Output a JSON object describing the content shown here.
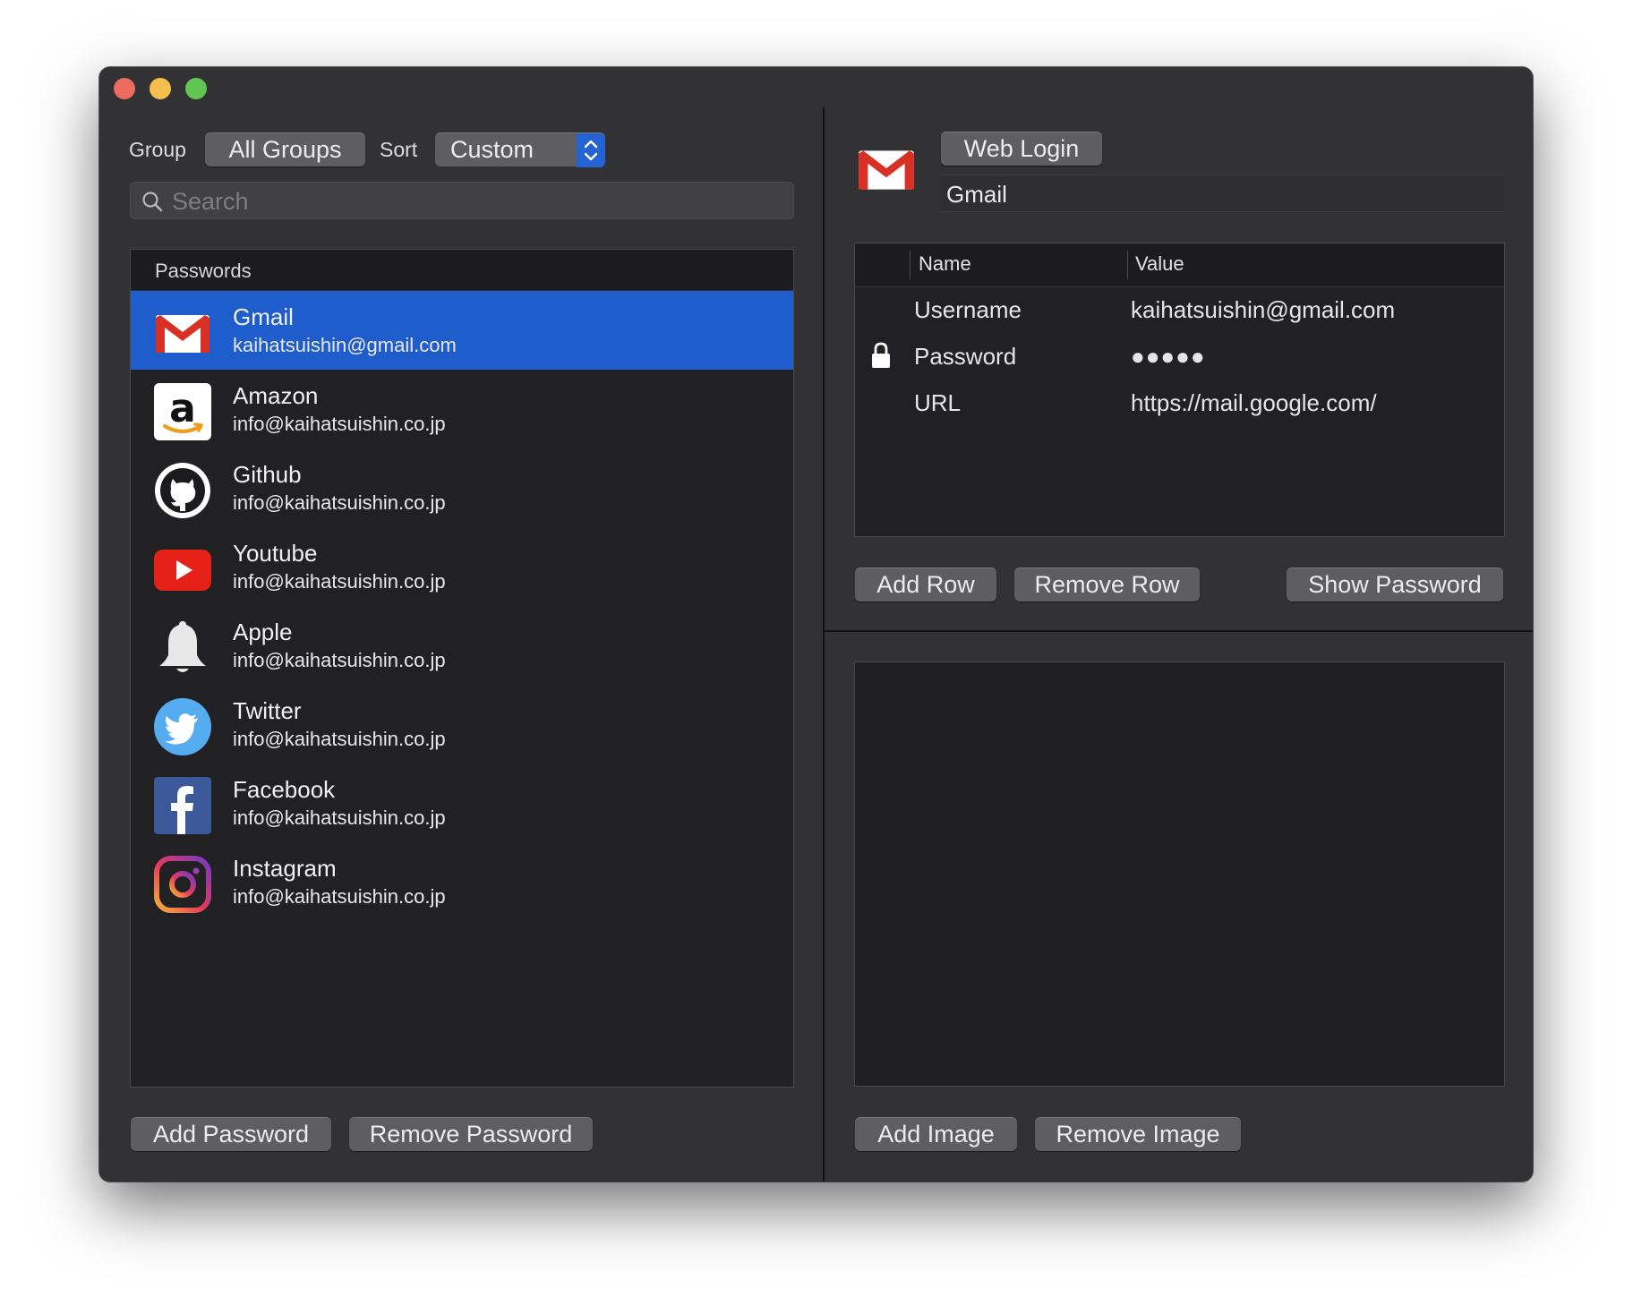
{
  "toolbar": {
    "group_label": "Group",
    "group_value": "All Groups",
    "sort_label": "Sort",
    "sort_value": "Custom",
    "search_placeholder": "Search"
  },
  "list": {
    "header": "Passwords",
    "items": [
      {
        "title": "Gmail",
        "subtitle": "kaihatsuishin@gmail.com",
        "icon": "gmail-icon",
        "selected": true
      },
      {
        "title": "Amazon",
        "subtitle": "info@kaihatsuishin.co.jp",
        "icon": "amazon-icon"
      },
      {
        "title": "Github",
        "subtitle": "info@kaihatsuishin.co.jp",
        "icon": "github-icon"
      },
      {
        "title": "Youtube",
        "subtitle": "info@kaihatsuishin.co.jp",
        "icon": "youtube-icon"
      },
      {
        "title": "Apple",
        "subtitle": "info@kaihatsuishin.co.jp",
        "icon": "bell-icon"
      },
      {
        "title": "Twitter",
        "subtitle": "info@kaihatsuishin.co.jp",
        "icon": "twitter-icon"
      },
      {
        "title": "Facebook",
        "subtitle": "info@kaihatsuishin.co.jp",
        "icon": "facebook-icon"
      },
      {
        "title": "Instagram",
        "subtitle": "info@kaihatsuishin.co.jp",
        "icon": "instagram-icon"
      }
    ]
  },
  "left_buttons": {
    "add": "Add Password",
    "remove": "Remove Password"
  },
  "detail": {
    "type_button": "Web Login",
    "title": "Gmail",
    "table": {
      "columns": [
        "Name",
        "Value"
      ],
      "rows": [
        {
          "name": "Username",
          "value": "kaihatsuishin@gmail.com",
          "locked": false
        },
        {
          "name": "Password",
          "value": "●●●●●",
          "locked": true
        },
        {
          "name": "URL",
          "value": "https://mail.google.com/",
          "locked": false
        }
      ]
    },
    "add_row": "Add Row",
    "remove_row": "Remove Row",
    "show_password": "Show Password",
    "add_image": "Add Image",
    "remove_image": "Remove Image"
  },
  "colors": {
    "window_bg": "#323234",
    "selection": "#1f5ccc",
    "list_bg": "#212123"
  }
}
